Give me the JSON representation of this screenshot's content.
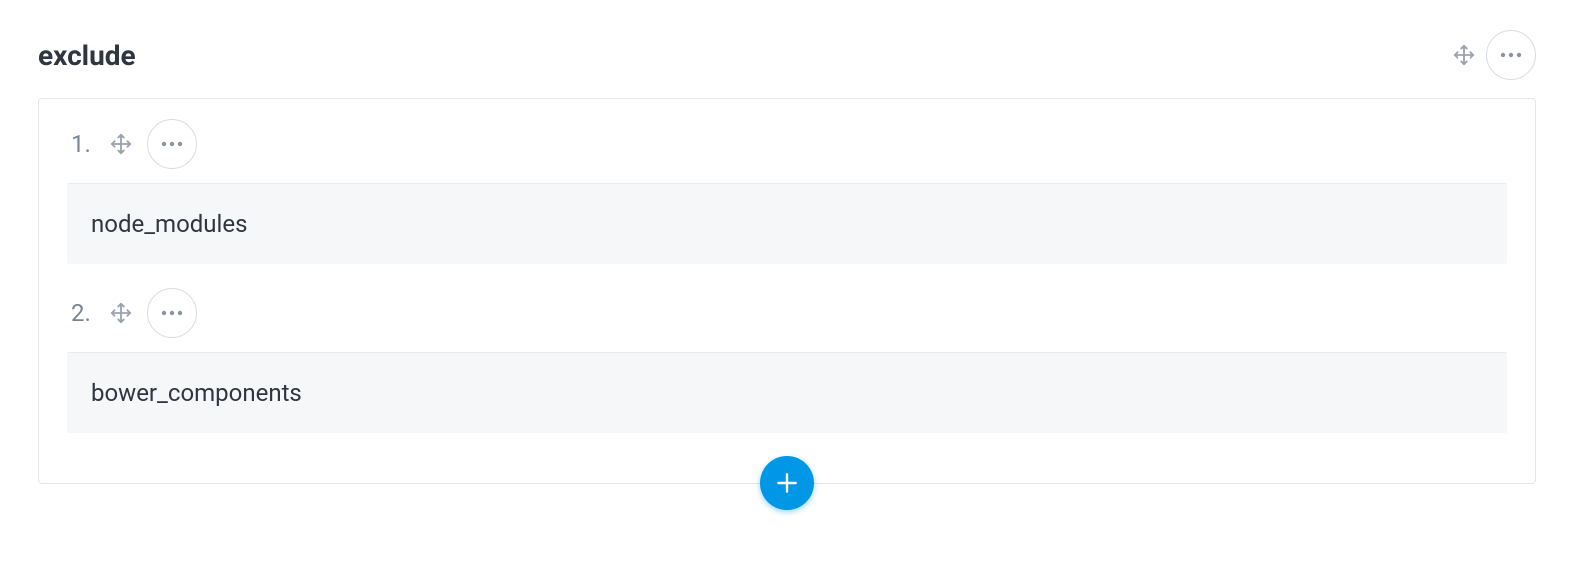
{
  "section": {
    "title": "exclude"
  },
  "items": [
    {
      "index": "1.",
      "value": "node_modules"
    },
    {
      "index": "2.",
      "value": "bower_components"
    }
  ],
  "colors": {
    "accent": "#0097e6",
    "border": "#e2e7ec",
    "muted": "#7a8593",
    "input_bg": "#f5f7f9"
  }
}
